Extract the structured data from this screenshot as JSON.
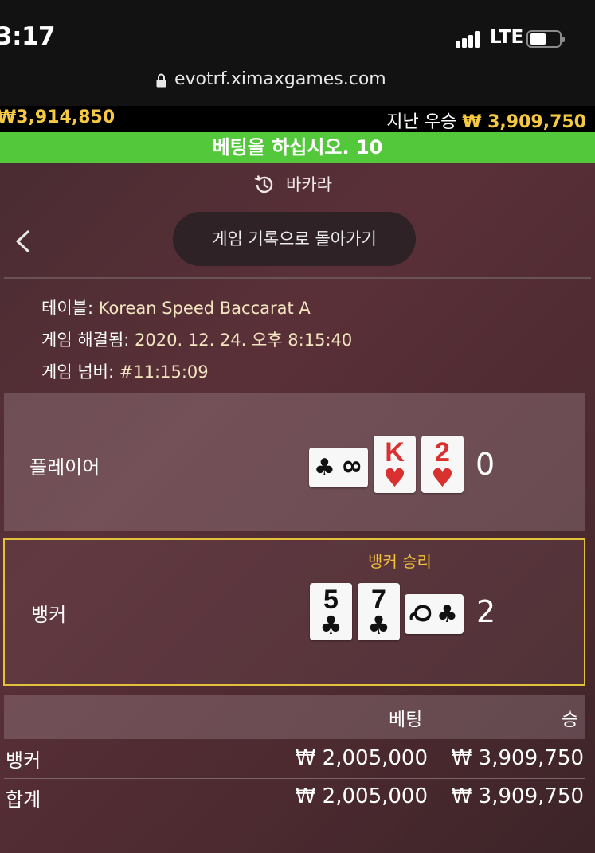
{
  "status": {
    "time": "3:17",
    "network": "LTE"
  },
  "browser": {
    "url": "evotrf.ximaxgames.com"
  },
  "balance": {
    "left_amount": "₩3,914,850",
    "last_win_label": "지난 우승",
    "last_win_amount": "₩ 3,909,750"
  },
  "banner": {
    "text": "베팅을 하십시오. 10"
  },
  "header": {
    "game_name": "바카라",
    "back_pill": "게임 기록으로 돌아가기"
  },
  "details": {
    "table_label": "테이블:",
    "table_value": "Korean Speed Baccarat A",
    "resolved_label": "게임 해결됨:",
    "resolved_value": "2020. 12. 24. 오후 8:15:40",
    "number_label": "게임 넘버:",
    "number_value": "#11:15:09"
  },
  "player": {
    "label": "플레이어",
    "score": "0",
    "cards": [
      {
        "rank": "8",
        "suit": "♣",
        "color": "#111111",
        "side": true
      },
      {
        "rank": "K",
        "suit": "♥",
        "color": "#d93030",
        "side": false
      },
      {
        "rank": "2",
        "suit": "♥",
        "color": "#d93030",
        "side": false
      }
    ]
  },
  "banker": {
    "label": "뱅커",
    "score": "2",
    "win_label": "뱅커 승리",
    "cards": [
      {
        "rank": "5",
        "suit": "♣",
        "color": "#111111",
        "side": false
      },
      {
        "rank": "7",
        "suit": "♣",
        "color": "#111111",
        "side": false
      },
      {
        "rank": "Q",
        "suit": "♣",
        "color": "#111111",
        "side": true
      }
    ]
  },
  "bets_table": {
    "col_bet": "베팅",
    "col_win": "승",
    "rows": [
      {
        "label": "뱅커",
        "bet": "₩ 2,005,000",
        "win": "₩ 3,909,750"
      },
      {
        "label": "합계",
        "bet": "₩ 2,005,000",
        "win": "₩ 3,909,750"
      }
    ]
  },
  "colors": {
    "accent_gold": "#f4c842",
    "banner_green": "#52c83a",
    "banker_border": "#e3c13a"
  }
}
